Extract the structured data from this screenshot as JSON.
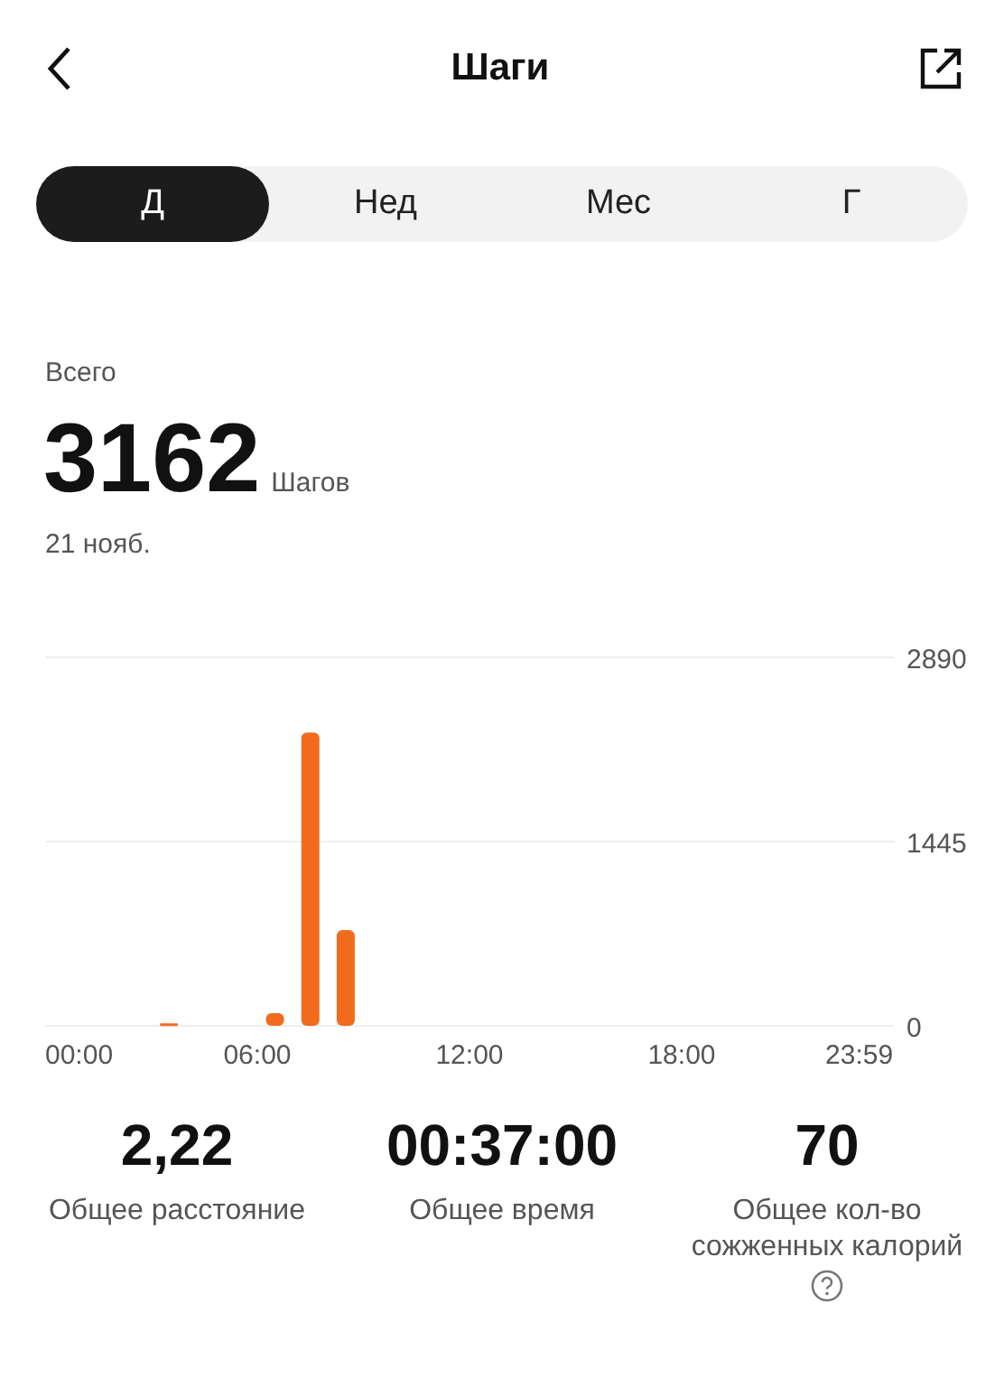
{
  "header": {
    "title": "Шаги"
  },
  "tabs": [
    {
      "label": "Д",
      "selected": true
    },
    {
      "label": "Нед",
      "selected": false
    },
    {
      "label": "Мес",
      "selected": false
    },
    {
      "label": "Г",
      "selected": false
    }
  ],
  "summary": {
    "caption": "Всего",
    "value": "3162",
    "unit": "Шагов",
    "date": "21 нояб."
  },
  "chart_data": {
    "type": "bar",
    "x": [
      3.5,
      6.5,
      7.5,
      8.5
    ],
    "series": [
      {
        "color": "#f26b1d",
        "values": [
          20,
          100,
          2300,
          750
        ]
      }
    ],
    "xlim": [
      0,
      24
    ],
    "ylim": [
      0,
      2890
    ],
    "yticks": [
      0,
      1445,
      2890
    ],
    "xticks": [
      {
        "value": 0,
        "label": "00:00"
      },
      {
        "value": 6,
        "label": "06:00"
      },
      {
        "value": 12,
        "label": "12:00"
      },
      {
        "value": 18,
        "label": "18:00"
      },
      {
        "value": 23.98,
        "label": "23:59"
      }
    ]
  },
  "stats": [
    {
      "value": "2,22",
      "label": "Общее расстояние",
      "help": false
    },
    {
      "value": "00:37:00",
      "label": "Общее время",
      "help": false
    },
    {
      "value": "70",
      "label": "Общее кол-во сожженных калорий",
      "help": true
    }
  ]
}
